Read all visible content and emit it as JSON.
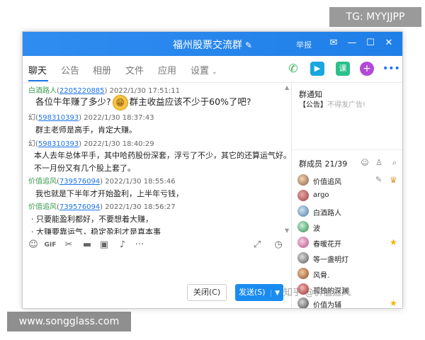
{
  "watermarks": {
    "top": "TG: MYYJJPP",
    "bottom": "www.songglass.com",
    "zhihu": "知乎 @价值追风"
  },
  "window": {
    "title": "福州股票交流群",
    "report": "举报"
  },
  "tabs": [
    {
      "label": "聊天"
    },
    {
      "label": "公告"
    },
    {
      "label": "相册"
    },
    {
      "label": "文件"
    },
    {
      "label": "应用"
    },
    {
      "label": "设置"
    }
  ],
  "messages": [
    {
      "name": "白酒路人",
      "id": "2205220885",
      "time": "2022/1/30 17:51:11",
      "text_a": "各位牛年赚了多少?",
      "text_b": "群主收益应该不少于60%了吧?"
    },
    {
      "name": "幻",
      "id": "598310393",
      "time": "2022/1/30 18:37:43",
      "text": "群主老师是高手，肯定大赚。"
    },
    {
      "name": "幻",
      "id": "598310393",
      "time": "2022/1/30 18:40:29",
      "text": "本人去年总体平手，其中哈药股份深套，浮亏了不少，其它的还算运气好。这",
      "text2": "不一月份又有几个股上套了。"
    },
    {
      "name": "价值追风",
      "id": "739576094",
      "time": "2022/1/30 18:55:46",
      "text": "我也就是下半年才开始盈利，上半年亏钱，"
    },
    {
      "name": "价值追风",
      "id": "739576094",
      "time": "2022/1/30 18:56:27",
      "text": "只要能盈利都好，不要想着大赚，",
      "text2": "大赚要靠运气，稳定盈利才是真本事"
    }
  ],
  "buttons": {
    "close": "关闭(C)",
    "send": "发送(S)"
  },
  "sidebar": {
    "notice_title": "群通知",
    "notice_prefix": "【公告】",
    "notice_placeholder": "不得发广告!",
    "members_label": "群成员 21/39",
    "members": [
      {
        "name": "价值追风"
      },
      {
        "name": "argo"
      },
      {
        "name": "白酒路人"
      },
      {
        "name": "波"
      },
      {
        "name": "春暖花开"
      },
      {
        "name": "等一盏明灯"
      },
      {
        "name": "风骨."
      },
      {
        "name": "孤独的深渊"
      },
      {
        "name": "价值为辅"
      }
    ]
  },
  "colors": {
    "accent": "#1f7fe8",
    "green_name": "#3a9b4e",
    "id_link": "#1a73e8",
    "crown": "#f5b400"
  }
}
